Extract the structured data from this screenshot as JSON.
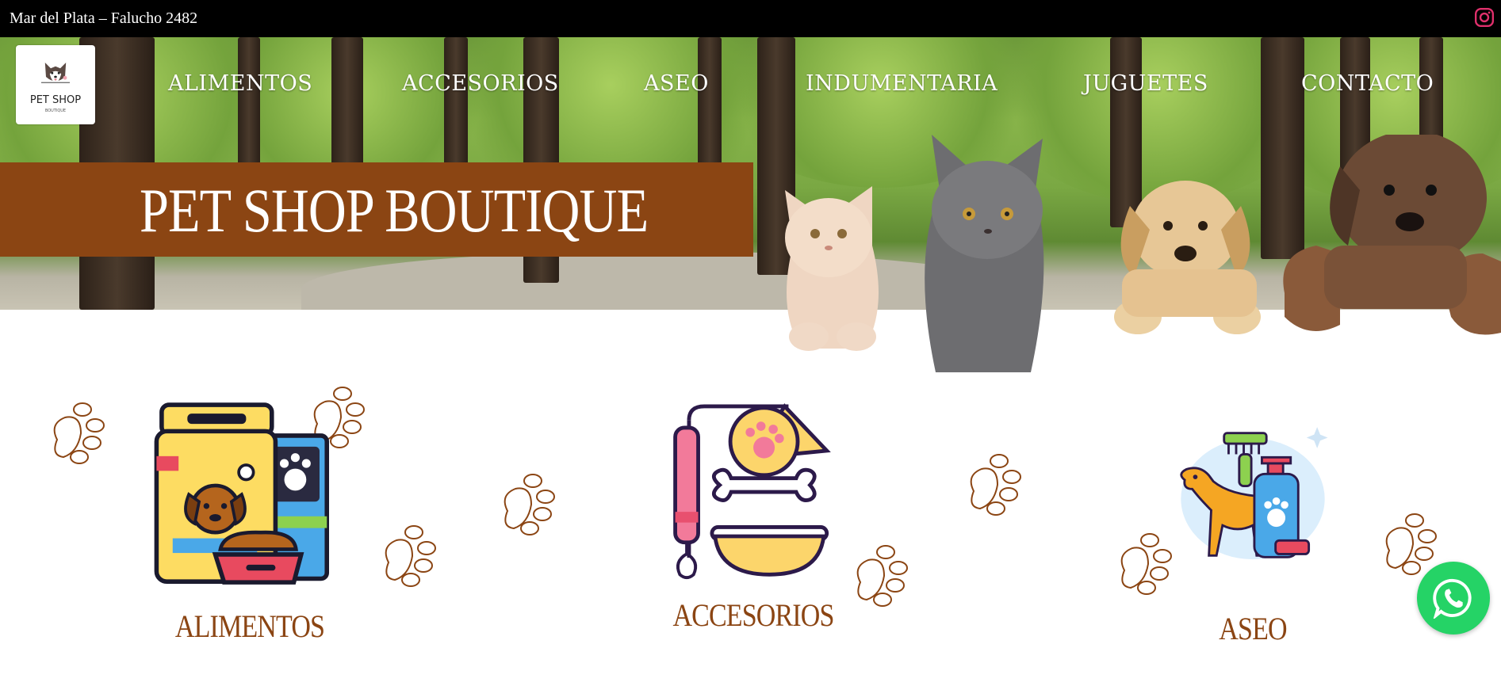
{
  "topbar": {
    "address": "Mar del Plata – Falucho 2482",
    "social_icon": "instagram-icon"
  },
  "logo": {
    "title": "PET SHOP",
    "subtitle": "BOUTIQUE"
  },
  "nav": {
    "items": [
      "ALIMENTOS",
      "ACCESORIOS",
      "ASEO",
      "INDUMENTARIA",
      "JUGUETES",
      "CONTACTO"
    ]
  },
  "hero": {
    "title": "PET SHOP BOUTIQUE"
  },
  "categories": [
    {
      "label": "ALIMENTOS",
      "icon": "pet-food-icon"
    },
    {
      "label": "ACCESORIOS",
      "icon": "pet-accessories-icon"
    },
    {
      "label": "ASEO",
      "icon": "pet-grooming-icon"
    }
  ],
  "whatsapp": {
    "icon": "whatsapp-icon"
  },
  "colors": {
    "brand_brown": "#8b4513",
    "topbar": "#000000",
    "whatsapp": "#25d366",
    "instagram": "#e1306c"
  }
}
